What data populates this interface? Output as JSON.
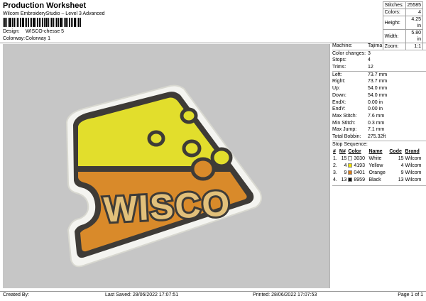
{
  "header": {
    "title": "Production Worksheet",
    "subtitle": "Wilcom EmbroideryStudio – Level 3 Advanced",
    "design_label": "Design:",
    "design_value": "WISCO-chesse 5",
    "colorway_label": "Colorway:",
    "colorway_value": "Colorway 1"
  },
  "stats": [
    {
      "label": "Stitches:",
      "value": "25585"
    },
    {
      "label": "Colors:",
      "value": "4"
    },
    {
      "label": "Height:",
      "value": "4.25 in"
    },
    {
      "label": "Width:",
      "value": "5.80 in"
    },
    {
      "label": "Zoom:",
      "value": "1:1"
    }
  ],
  "machine_info": [
    {
      "label": "Machine:",
      "value": "Tajima"
    },
    {
      "label": "Color changes:",
      "value": "3"
    },
    {
      "label": "Stops:",
      "value": "4"
    },
    {
      "label": "Trims:",
      "value": "12"
    },
    {
      "label": "Left:",
      "value": "73.7 mm"
    },
    {
      "label": "Right:",
      "value": "73.7 mm"
    },
    {
      "label": "Up:",
      "value": "54.0 mm"
    },
    {
      "label": "Down:",
      "value": "54.0 mm"
    },
    {
      "label": "EndX:",
      "value": "0.00 in"
    },
    {
      "label": "EndY:",
      "value": "0.00 in"
    },
    {
      "label": "Max Stitch:",
      "value": "7.6 mm"
    },
    {
      "label": "Min Stitch:",
      "value": "0.3 mm"
    },
    {
      "label": "Max Jump:",
      "value": "7.1 mm"
    },
    {
      "label": "Total Bobbin:",
      "value": "275.32ft"
    }
  ],
  "stop_sequence": {
    "title": "Stop Sequence:",
    "headers": [
      "#",
      "N#",
      "Color",
      "Name",
      "Code",
      "Brand"
    ],
    "rows": [
      {
        "num": "1.",
        "n": "15",
        "color": "#ffffff",
        "code_color": "3030",
        "name": "White",
        "code": "15",
        "brand": "Wilcom"
      },
      {
        "num": "2.",
        "n": "4",
        "color": "#f2e300",
        "code_color": "4193",
        "name": "Yellow",
        "code": "4",
        "brand": "Wilcom"
      },
      {
        "num": "3.",
        "n": "9",
        "color": "#dd7a12",
        "code_color": "0401",
        "name": "Orange",
        "code": "9",
        "brand": "Wilcom"
      },
      {
        "num": "4.",
        "n": "13",
        "color": "#111111",
        "code_color": "8959",
        "name": "Black",
        "code": "13",
        "brand": "Wilcom"
      }
    ]
  },
  "design_text": "WISCO",
  "colors": {
    "background": "#c6c6c6",
    "white_border": "#f4f4f0",
    "yellow": "#e2de2c",
    "orange": "#d98a2a",
    "outline": "#3e3b37"
  },
  "footer": {
    "created_by": "Created By:",
    "last_saved": "Last Saved: 28/06/2022 17:07:51",
    "printed": "Printed: 28/06/2022 17:07:53",
    "page": "Page 1 of 1"
  }
}
